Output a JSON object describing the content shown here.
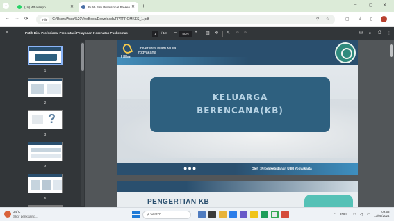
{
  "browser": {
    "tabs": [
      {
        "label": "(10) WhatsApp",
        "active": false
      },
      {
        "label": "Putih Biru Profesional Presen",
        "active": true
      }
    ],
    "new_tab": "+",
    "controls": {
      "minimize": "–",
      "maximize": "▢",
      "close": "✕"
    },
    "address": {
      "chip": "File",
      "url": "C:/Users/Asus%20VivoBook/Downloads/PPTPROMKES_1.pdf"
    }
  },
  "pdf_toolbar": {
    "title": "Putih Biru Profesional Presentasi Pelayanan Kesehatan Puskesmas",
    "current_page": "1",
    "total_pages": "/ 18",
    "zoom": "50%"
  },
  "thumbnails": [
    {
      "number": "1"
    },
    {
      "number": "2"
    },
    {
      "number": "3"
    },
    {
      "number": "4"
    },
    {
      "number": "5"
    },
    {
      "number": "6"
    }
  ],
  "slide1": {
    "university_line1": "Universitas Islam Mulia",
    "university_line2": "Yogyakarta",
    "logo_text": "UIIm",
    "title_line1": "KELUARGA",
    "title_line2": "BERENCANA(KB)",
    "dots": "●●●",
    "author": "Oleh : Prodi kebidanan UIIM Yogyakarta"
  },
  "slide2": {
    "title": "PENGERTIAN KB"
  },
  "taskbar": {
    "weather_temp": "34°C",
    "weather_desc": "Skor periksaing...",
    "search_placeholder": "Search",
    "lang": "IND",
    "time": "09:53",
    "date": "13/05/2024"
  },
  "colors": {
    "slide_navy": "#2a4f6e",
    "kb_box": "#2e607f",
    "pdf_toolbar": "#323639",
    "viewer_bg": "#525659",
    "tabbar": "#dcebd8"
  }
}
